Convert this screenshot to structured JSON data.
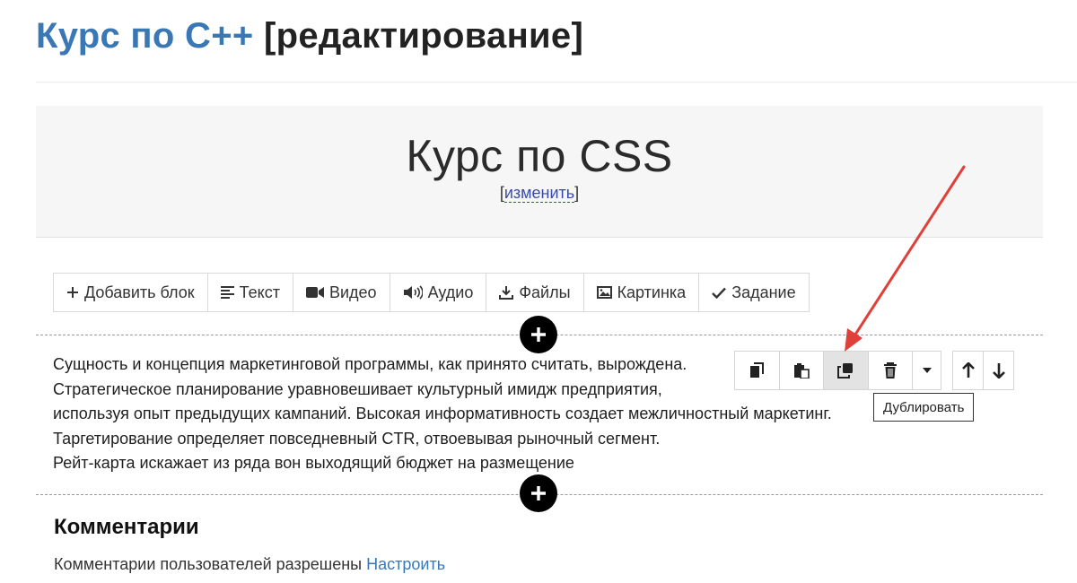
{
  "header": {
    "course_name": "Курс по С++",
    "edit_suffix": "[редактирование]"
  },
  "hero": {
    "title": "Курс по CSS",
    "edit_open": "[",
    "edit_link": "изменить",
    "edit_close": "]"
  },
  "toolbar": {
    "items": [
      {
        "label": "Добавить блок",
        "icon": "plus-icon"
      },
      {
        "label": "Текст",
        "icon": "align-left-icon"
      },
      {
        "label": "Видео",
        "icon": "video-camera-icon"
      },
      {
        "label": "Аудио",
        "icon": "speaker-icon"
      },
      {
        "label": "Файлы",
        "icon": "download-icon"
      },
      {
        "label": "Картинка",
        "icon": "image-icon"
      },
      {
        "label": "Задание",
        "icon": "check-icon"
      }
    ]
  },
  "content_block": {
    "lines": [
      "Сущность и концепция маркетинговой программы, как принято считать, вырождена.",
      "Стратегическое планирование уравновешивает культурный имидж предприятия,",
      "используя опыт предыдущих кампаний. Высокая информативность создает межличностный маркетинг.",
      "Таргетирование определяет повседневный CTR, отвоевывая рыночный сегмент.",
      "Рейт-карта искажает из ряда вон выходящий бюджет на размещение"
    ]
  },
  "block_actions": {
    "icons": [
      "copy-icon",
      "paste-icon",
      "duplicate-icon",
      "trash-icon",
      "caret-down-icon",
      "arrow-up-icon",
      "arrow-down-icon"
    ],
    "active": "duplicate-icon",
    "tooltip": "Дублировать"
  },
  "annotation": {
    "arrow_color": "#e0403a"
  },
  "comments": {
    "title": "Комментарии",
    "status": "Комментарии пользователей разрешены",
    "settings_link": "Настроить"
  }
}
